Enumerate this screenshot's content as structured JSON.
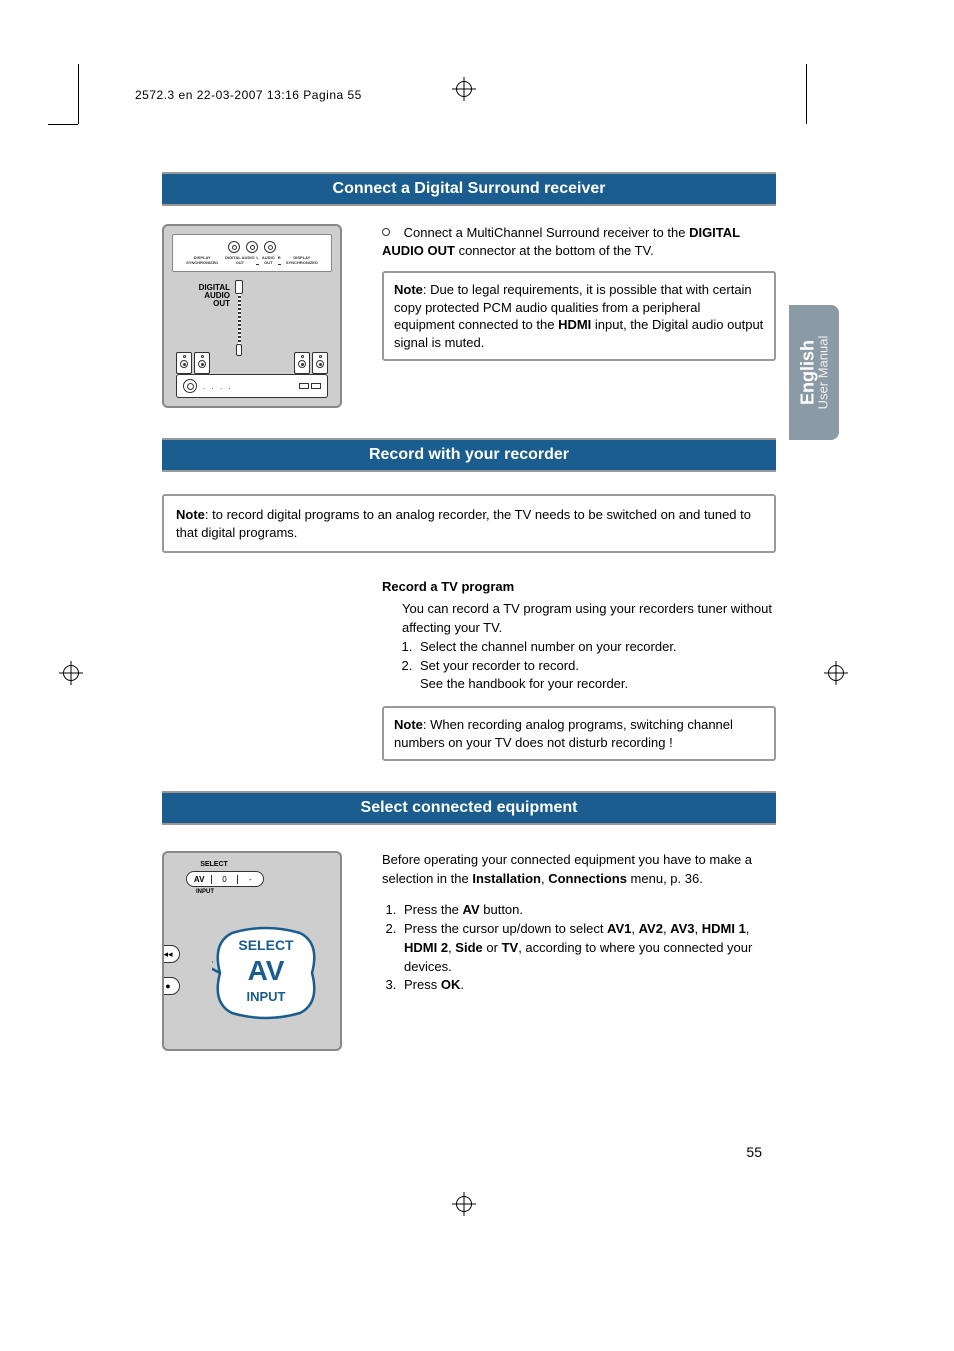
{
  "header_line": "2572.3 en  22-03-2007  13:16  Pagina 55",
  "side_tab": {
    "lang": "English",
    "sub": "User Manual"
  },
  "page_number": "55",
  "section1": {
    "banner": "Connect a Digital Surround receiver",
    "diagram": {
      "jack_group_label": "DIGITAL AUDIO OUT",
      "audio_label": "AUDIO OUT",
      "sync1": "DISPLAY SYNCHRONIZED",
      "sync2": "DISPLAY SYNCHRONIZED",
      "dao_label": "DIGITAL AUDIO OUT"
    },
    "para_prefix": "Connect a MultiChannel Surround receiver to the ",
    "bold1": "DIGITAL AUDIO OUT",
    "para_suffix": " connector at the bottom of the TV.",
    "note_label": "Note",
    "note_body1": ": Due to legal requirements, it is possible that with certain copy protected PCM audio qualities from a peripheral equipment connected to the ",
    "note_bold": "HDMI",
    "note_body2": " input, the Digital audio output signal is muted."
  },
  "section2": {
    "banner": "Record with your recorder",
    "note_label": "Note",
    "note_body": ": to record digital programs to an analog recorder, the TV needs to be switched on and tuned to that digital programs.",
    "heading": "Record a TV program",
    "intro": "You can record a TV program using your recorders tuner without affecting your TV.",
    "step1": "Select the channel number on your recorder.",
    "step2": "Set your recorder to record.",
    "step2_sub": "See the handbook for your recorder.",
    "note2_label": "Note",
    "note2_body": ": When recording analog programs, switching channel numbers on your TV does not disturb recording !"
  },
  "section3": {
    "banner": "Select connected equipment",
    "diagram": {
      "select_small": "SELECT",
      "av_small": "AV",
      "zero": "0",
      "dash": "-",
      "input_small": "INPUT",
      "bubble_select": "SELECT",
      "bubble_av": "AV",
      "bubble_input": "INPUT",
      "rewind_glyph": "◂◂",
      "dot_glyph": "●"
    },
    "intro_pre": "Before operating your connected equipment you have to make a selection in the ",
    "bold_install": "Installation",
    "comma": ", ",
    "bold_conn": "Connections",
    "intro_post": " menu, p. 36.",
    "step1_pre": "Press the ",
    "step1_bold": "AV",
    "step1_post": " button.",
    "step2_pre": "Press the cursor up/down to select ",
    "av1": "AV1",
    "av2": "AV2",
    "av3": "AV3",
    "hdmi1": "HDMI 1",
    "hdmi2": "HDMI 2",
    "side": "Side",
    "tv": "TV",
    "step2_post": ", according to where you connected your devices.",
    "step3_pre": "Press ",
    "step3_bold": "OK",
    "step3_post": "."
  }
}
